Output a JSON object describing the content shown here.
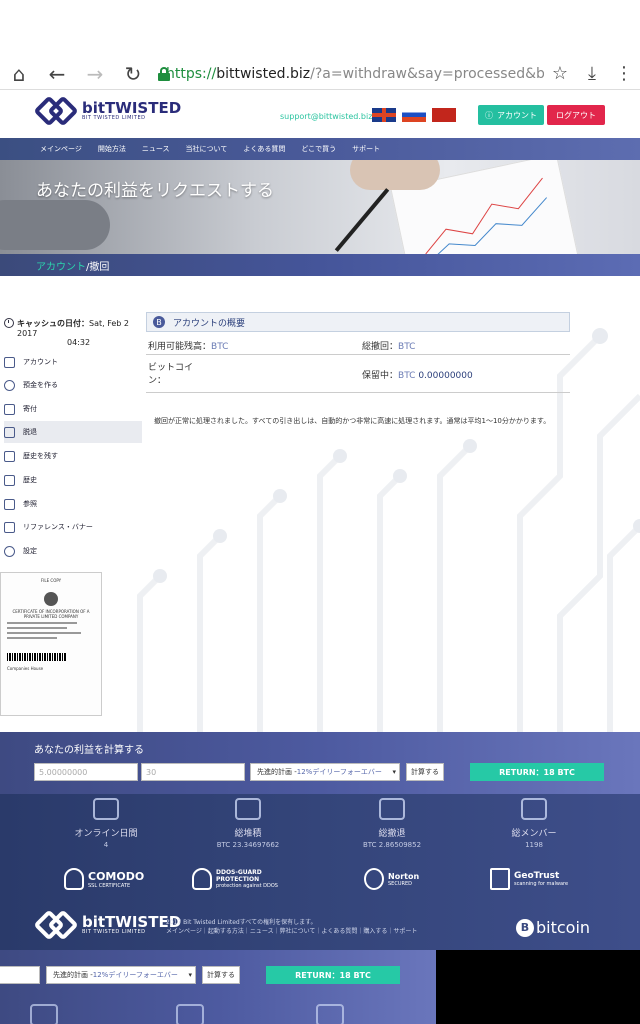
{
  "browser": {
    "url_scheme": "https://",
    "url_host": "bittwisted.biz",
    "url_path": "/?a=withdraw&say=processed&batch=CV",
    "home_icon": "home-icon",
    "back_icon": "arrow-left-icon",
    "forward_icon": "arrow-right-icon",
    "reload_icon": "reload-icon",
    "star_icon": "star-icon",
    "download_icon": "download-icon",
    "menu_icon": "kebab-menu-icon"
  },
  "header": {
    "logo_big": "bitTWISTED",
    "logo_small": "BIT TWISTED LIMITED",
    "support_email": "support@bittwisted.biz",
    "account_label": "アカウント",
    "logout_label": "ログアウト"
  },
  "nav": {
    "items": [
      "メインページ",
      "開始方法",
      "ニュース",
      "当社について",
      "よくある質問",
      "どこで買う",
      "サポート"
    ]
  },
  "hero": {
    "title": "あなたの利益をリクエストする"
  },
  "breadcrumb": {
    "account": "アカウント",
    "current": "/撤回"
  },
  "sidebar": {
    "cash_date_label": "キャッシュの日付：",
    "cash_date_value": "Sat, Feb 2 2017",
    "cash_time_value": "04:32",
    "items": [
      {
        "label": "アカウント",
        "icon": "account-icon"
      },
      {
        "label": "預金を作る",
        "icon": "plus-circle-icon"
      },
      {
        "label": "寄付",
        "icon": "gift-icon"
      },
      {
        "label": "脱退",
        "icon": "withdraw-icon",
        "active": true
      },
      {
        "label": "歴史を残す",
        "icon": "history-icon"
      },
      {
        "label": "歴史",
        "icon": "list-icon"
      },
      {
        "label": "参照",
        "icon": "tree-icon"
      },
      {
        "label": "リファレンス・バナー",
        "icon": "megaphone-icon"
      },
      {
        "label": "設定",
        "icon": "gear-icon"
      }
    ],
    "cert": {
      "heading": "FILE COPY",
      "title": "CERTIFICATE OF INCORPORATION OF A PRIVATE LIMITED COMPANY",
      "footer": "Companies House"
    }
  },
  "overview": {
    "heading": "アカウントの概要",
    "available_label": "利用可能残高：",
    "available_unit": "BTC",
    "total_withdraw_label": "総撤回：",
    "total_withdraw_unit": "BTC",
    "bitcoin_label_1": "ビットコイ",
    "bitcoin_label_2": "ン：",
    "pending_label": "保留中：",
    "pending_unit": "BTC",
    "pending_value": "0.00000000"
  },
  "notice": "撤回が正常に処理されました。すべての引き出しは、自動的かつ非常に高速に処理されます。通常は平均1〜10分かかります。",
  "calculator": {
    "title": "あなたの利益を計算する",
    "amount_placeholder": "5.00000000",
    "days_placeholder": "30",
    "plan_label_prefix": "先進的計画 - ",
    "plan_label_rate": "12%デイリーフォーエバー",
    "calc_button": "計算する",
    "return_label": "RETURN：18 BTC"
  },
  "stats": [
    {
      "label": "オンライン日間",
      "value": "4",
      "icon": "calendar-icon"
    },
    {
      "label": "総堆積",
      "value": "BTC 23.34697662",
      "icon": "lock-bag-icon"
    },
    {
      "label": "総撤退",
      "value": "BTC 2.86509852",
      "icon": "money-icon"
    },
    {
      "label": "総メンバー",
      "value": "1198",
      "icon": "users-icon"
    }
  ],
  "badges": {
    "comodo": "COMODO",
    "comodo_sub": "SSL CERTIFICATE",
    "ddos": "DDOS-GUARD PROTECTION",
    "ddos_sub": "protection against DDOS",
    "norton": "Norton",
    "norton_sub": "SECURED",
    "geotrust": "GeoTrust",
    "geotrust_sub": "scanning for malware"
  },
  "footer": {
    "copyright": "2017 Bit Twisted Limitedすべての権利を保有します。",
    "links": "メインページ｜起動する方法｜ニュース｜弊社について｜よくある質問｜購入する｜サポート",
    "bitcoin": "bitcoin"
  },
  "colors": {
    "brand": "#2a2c7a",
    "accent_green": "#26c9a6",
    "logout_red": "#e2264b"
  }
}
